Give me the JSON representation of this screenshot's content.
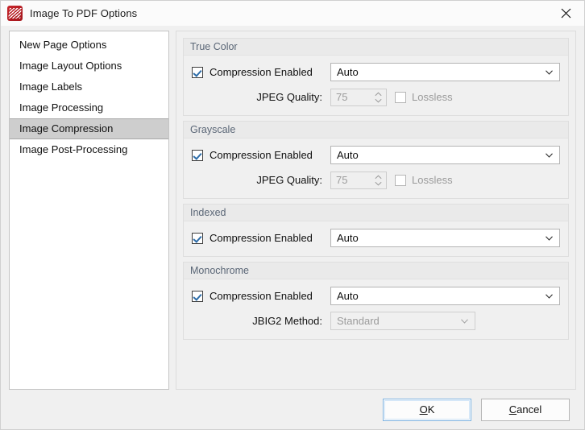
{
  "window": {
    "title": "Image To PDF Options",
    "app_icon": "pdf-xchange-icon",
    "close_icon": "close-icon",
    "accent_color": "#2d6ca8",
    "icon_color": "#b01c22"
  },
  "sidebar": {
    "items": [
      {
        "label": "New Page Options",
        "selected": false
      },
      {
        "label": "Image Layout Options",
        "selected": false
      },
      {
        "label": "Image Labels",
        "selected": false
      },
      {
        "label": "Image Processing",
        "selected": false
      },
      {
        "label": "Image Compression",
        "selected": true
      },
      {
        "label": "Image Post-Processing",
        "selected": false
      }
    ]
  },
  "groups": [
    {
      "title": "True Color",
      "compression": {
        "label": "Compression Enabled",
        "checked": true
      },
      "combo": {
        "value": "Auto",
        "enabled": true
      },
      "quality": {
        "label": "JPEG Quality:",
        "value": "75",
        "enabled": false
      },
      "lossless": {
        "label": "Lossless",
        "checked": false,
        "enabled": false
      }
    },
    {
      "title": "Grayscale",
      "compression": {
        "label": "Compression Enabled",
        "checked": true
      },
      "combo": {
        "value": "Auto",
        "enabled": true
      },
      "quality": {
        "label": "JPEG Quality:",
        "value": "75",
        "enabled": false
      },
      "lossless": {
        "label": "Lossless",
        "checked": false,
        "enabled": false
      }
    },
    {
      "title": "Indexed",
      "compression": {
        "label": "Compression Enabled",
        "checked": true
      },
      "combo": {
        "value": "Auto",
        "enabled": true
      }
    },
    {
      "title": "Monochrome",
      "compression": {
        "label": "Compression Enabled",
        "checked": true
      },
      "combo": {
        "value": "Auto",
        "enabled": true
      },
      "jbig2": {
        "label": "JBIG2 Method:",
        "value": "Standard",
        "enabled": false
      }
    }
  ],
  "footer": {
    "ok": {
      "prefix": "",
      "accel": "O",
      "suffix": "K",
      "default": true
    },
    "cancel": {
      "prefix": "",
      "accel": "C",
      "suffix": "ancel",
      "default": false
    }
  }
}
